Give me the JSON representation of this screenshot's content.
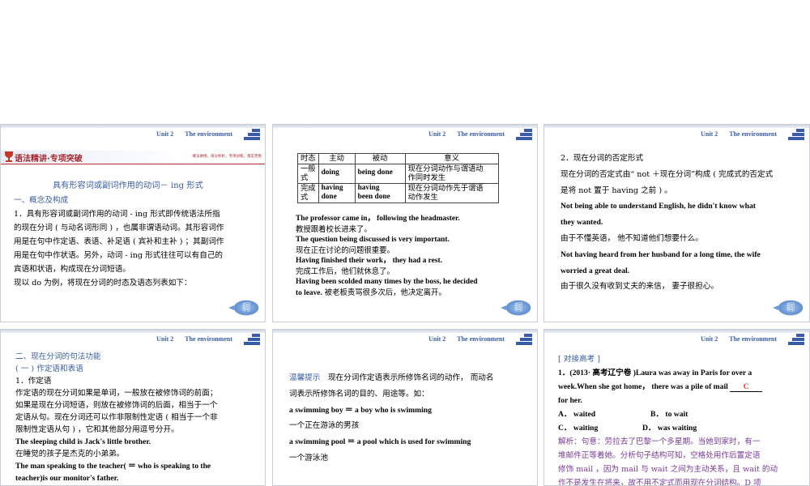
{
  "header": {
    "unit": "Unit 2",
    "env": "The environment"
  },
  "nav_button": {
    "line1": "返回",
    "line2": "导引"
  },
  "s1": {
    "banner_title": "语法精讲·专项突破",
    "banner_sub": "要法讲授，串分析析，专项训练，落实完善",
    "title": "具有形容词或副词作用的动词－ ing 形式",
    "sec1": "一、概念及构成",
    "p1_lines": [
      "1．具有形容词或副词作用的动词 - ing 形式即传统语法所指",
      "的现在分词 ( 与动名词形同 ) ，也属非谓语动词。其形容词作",
      "用是在句中作定语、表语、补足语 ( 宾补和主补 ) ；其副词作",
      "用是在句中作状语。另外，动词 - ing 形式往往可以有自己的",
      "宾语和状语，构成现在分词短语。"
    ],
    "p2": "现以 do 为例，将现在分词的时态及语态列表如下："
  },
  "s2": {
    "table": {
      "headers": [
        "时态",
        "主动",
        "被动",
        "意义"
      ],
      "rows": [
        {
          "c0a": "一般",
          "c0b": "式",
          "c1": "doing",
          "c2": "being done",
          "c3a": "现在分词动作与谓语动",
          "c3b": "作同时发生"
        },
        {
          "c0a": "完成",
          "c0b": "式",
          "c1a": "having",
          "c1b": "done",
          "c2a": "having",
          "c2b": "been done",
          "c3a": "现在分词动作先于谓语",
          "c3b": "动作发生"
        }
      ]
    },
    "lines": [
      {
        "en": "The professor came in， following the headmaster.",
        "zh": "教授跟着校长进来了。"
      },
      {
        "en": "The question being discussed is very important.",
        "zh": "现在正在讨论的问题很重要。"
      },
      {
        "en": "Having finished their work， they had a rest.",
        "zh": "完成工作后，他们就休息了。"
      }
    ],
    "last_en1": "Having been scolded many times by the boss, he decided",
    "last_en2": "to leave.",
    "last_zh": "被老板责骂很多次后，他决定离开。"
  },
  "s3": {
    "heading": "2．现在分词的否定形式",
    "p1a": "现在分词的否定式由“ not ＋现在分词”构成 ( 完成式的否定式",
    "p1b": "是将 not 置于 having 之前 ) 。",
    "ex1a": "Not being able to understand English, he didn't know what",
    "ex1b": "they wanted.",
    "zh1": "由于不懂英语， 他不知道他们想要什么。",
    "ex2a": "Not having heard from her husband for a long time, the wife",
    "ex2b": "worried a great deal.",
    "zh2": "由于很久没有收到丈夫的来信， 妻子很担心。"
  },
  "s4": {
    "sec2": "二、现在分词的句法功能",
    "sub1": "( 一 ) 作定语和表语",
    "h1": "1．作定语",
    "p_lines": [
      "作定语的现在分词如果是单词，一般放在被修饰词的前面；",
      "如果是现在分词短语，则放在被修饰词的后面，相当于一个",
      "定语从句。现在分词还可以作非限制性定语 ( 相当于一个非",
      "限制性定语从句 ) ，它和其他部分用逗号分开。"
    ],
    "ex1": "The sleeping child is Jack's little brother.",
    "zh1": "在睡觉的孩子是杰克的小弟弟。",
    "ex2a": "The man speaking to the teacher( ＝ who is speaking to the",
    "ex2b": "teacher)is our monitor's father."
  },
  "s5": {
    "tip_label": "温馨提示",
    "tip_a": "现在分词作定语表示所修饰名词的动作， 而动名",
    "tip_b": "词表示所修饰名词的目的、用途等。如：",
    "ex1": "a swimming boy ＝ a boy who is swimming",
    "zh1": "一个正在游泳的男孩",
    "ex2": "a swimming pool ＝ a pool which is used for swimming",
    "zh2": "一个游泳池"
  },
  "s6": {
    "tag": "[ 对接高考 ]",
    "q_a": "1．(2013· 高考辽宁卷 )Laura was away in Paris for over a",
    "q_b1": "week.When she got home， there was a pile of mail",
    "answer": "C",
    "q_c": "for her.",
    "optA": "A． waited",
    "optB": "B． to wait",
    "optC": "C． waiting",
    "optD": "D． was waiting",
    "ana_lines": [
      "解析：句意：劳拉去了巴黎一个多星期。当她到家时，有一",
      "堆邮件正等着她。分析句子结构可知，空格处用作后置定语",
      "修饰 mail ，因为 mail 与 wait 之间为主动关系，且 wait 的动",
      "作不是发生在将来，故不用不定式而用现在分词结构。D 项"
    ]
  }
}
